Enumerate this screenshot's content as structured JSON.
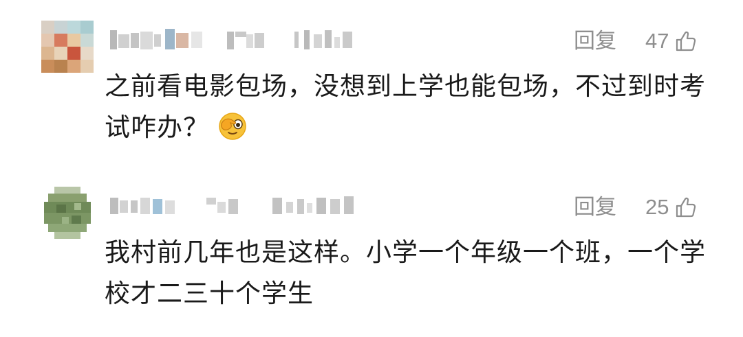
{
  "comments": [
    {
      "reply_label": "回复",
      "likes": "47",
      "text_line1": "之前看电影包场，没想到上学也能包场，不过到时考",
      "text_line2": "试咋办？",
      "emoji": "face-peeking-emoji"
    },
    {
      "reply_label": "回复",
      "likes": "25",
      "text_line1": "我村前几年也是这样。小学一个年级一个班，一个学",
      "text_line2": "校才二三十个学生"
    }
  ],
  "icons": {
    "like": "thumbs-up-icon"
  },
  "colors": {
    "meta_text": "#8e8e8e",
    "body_text": "#1a1a1a",
    "background": "#ffffff"
  }
}
